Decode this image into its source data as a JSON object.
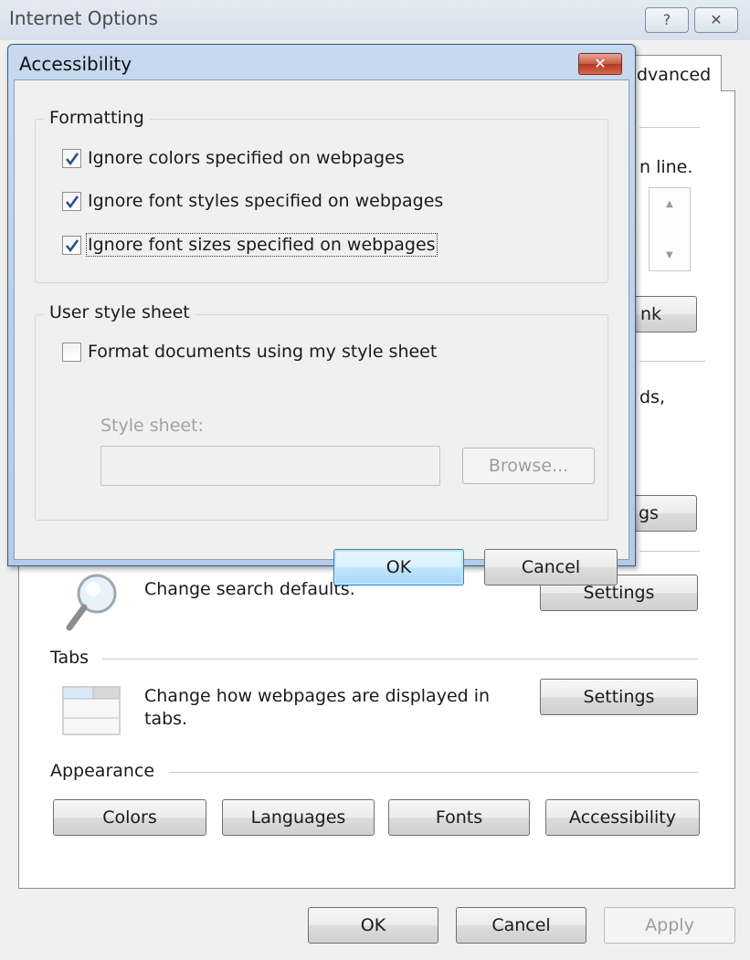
{
  "window": {
    "title": "Internet Options",
    "help_glyph": "?",
    "close_glyph": "✕"
  },
  "tabs": {
    "visible_tab": "dvanced"
  },
  "background": {
    "text_line": "n line.",
    "button_nk": "nk",
    "text_ds": "ds,",
    "button_gs": "gs"
  },
  "search": {
    "description": "Change search defaults.",
    "settings_button": "Settings"
  },
  "tabs_section": {
    "header": "Tabs",
    "description_line1": "Change how webpages are displayed in",
    "description_line2": "tabs.",
    "settings_button": "Settings"
  },
  "appearance": {
    "header": "Appearance",
    "buttons": [
      "Colors",
      "Languages",
      "Fonts",
      "Accessibility"
    ]
  },
  "footer": {
    "ok": "OK",
    "cancel": "Cancel",
    "apply": "Apply"
  },
  "dialog": {
    "title": "Accessibility",
    "close_glyph": "✕",
    "formatting": {
      "label": "Formatting",
      "options": [
        {
          "label": "Ignore colors specified on webpages",
          "checked": true
        },
        {
          "label": "Ignore font styles specified on webpages",
          "checked": true
        },
        {
          "label": "Ignore font sizes specified on webpages",
          "checked": true
        }
      ]
    },
    "user_style_sheet": {
      "label": "User style sheet",
      "option": {
        "label": "Format documents using my style sheet",
        "checked": false
      },
      "field_label": "Style sheet:",
      "field_value": "",
      "browse_button": "Browse..."
    },
    "ok": "OK",
    "cancel": "Cancel"
  }
}
